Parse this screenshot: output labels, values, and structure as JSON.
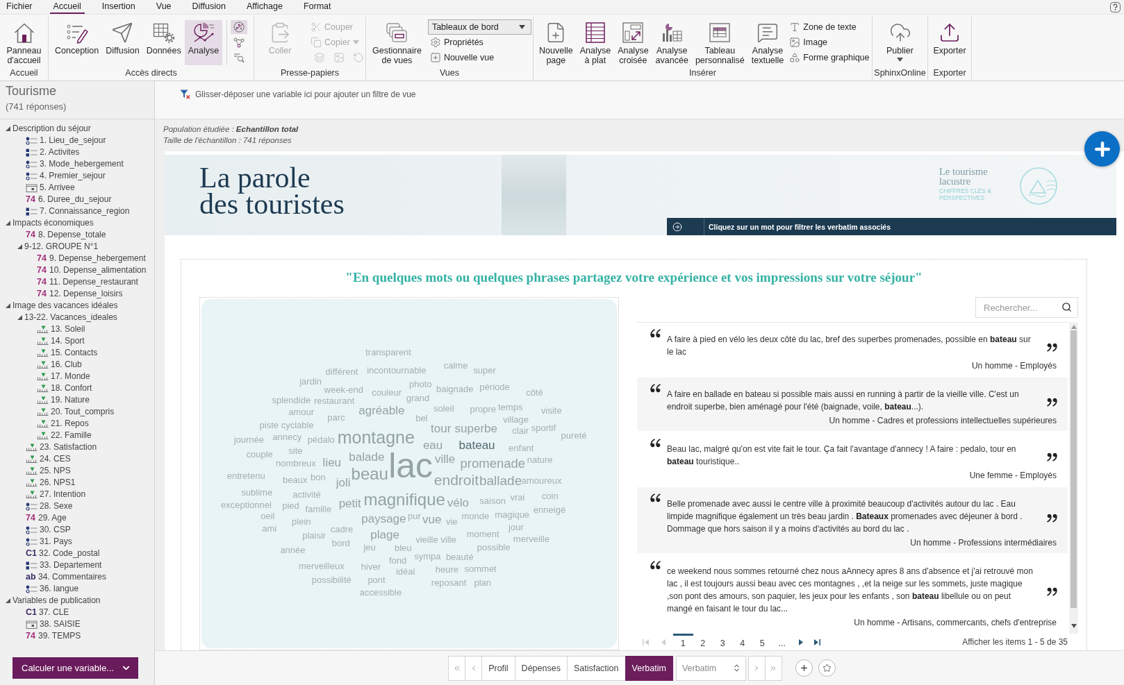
{
  "menu": [
    {
      "label": "Fichier",
      "selected": false
    },
    {
      "label": "Accueil",
      "selected": true
    },
    {
      "label": "Insertion",
      "selected": false
    },
    {
      "label": "Vue",
      "selected": false
    },
    {
      "label": "Diffusion",
      "selected": false
    },
    {
      "label": "Affichage",
      "selected": false
    },
    {
      "label": "Format",
      "selected": false
    }
  ],
  "ribbon": [
    {
      "label": "Accueil",
      "items": [
        {
          "kind": "large",
          "label": "Panneau\nd'accueil"
        }
      ]
    },
    {
      "label": "Accès directs",
      "items": [
        {
          "kind": "large",
          "label": "Conception",
          "selected": false
        },
        {
          "kind": "large",
          "label": "Diffusion",
          "selected": false
        },
        {
          "kind": "large",
          "label": "Données",
          "selected": false
        },
        {
          "kind": "large",
          "label": "Analyse",
          "selected": true
        },
        {
          "kind": "icon_stack",
          "items": [
            {
              "selected": true
            },
            {
              "selected": false
            },
            {
              "selected": false
            }
          ]
        }
      ]
    },
    {
      "label": "Presse-papiers",
      "items": [
        {
          "kind": "large",
          "label": "Coller",
          "disabled": true
        },
        {
          "kind": "stack",
          "items": [
            {
              "kind": "small",
              "label": "Couper",
              "disabled": true
            },
            {
              "kind": "small",
              "label": "Copier",
              "disabled": true,
              "caret": true
            },
            {
              "kind": "icons",
              "items": [
                {
                  "disabled": true
                },
                {
                  "disabled": true
                },
                {
                  "disabled": true
                }
              ]
            }
          ]
        }
      ]
    },
    {
      "label": "Vues",
      "items": [
        {
          "kind": "large",
          "label": "Gestionnaire\nde vues"
        },
        {
          "kind": "stack",
          "items": [
            {
              "kind": "dropdown",
              "value": "Tableaux de bord"
            },
            {
              "kind": "small",
              "label": "Propriétés"
            },
            {
              "kind": "small",
              "label": "Nouvelle vue"
            }
          ]
        }
      ]
    },
    {
      "label": "Insérer",
      "items": [
        {
          "kind": "large",
          "label": "Nouvelle\npage"
        },
        {
          "kind": "large",
          "label": "Analyse\nà plat"
        },
        {
          "kind": "large",
          "label": "Analyse\ncroisée"
        },
        {
          "kind": "large",
          "label": "Analyse\navancée"
        },
        {
          "kind": "large",
          "label": "Tableau\npersonnalisé"
        },
        {
          "kind": "large",
          "label": "Analyse\ntextuelle"
        },
        {
          "kind": "stack",
          "items": [
            {
              "kind": "small",
              "label": "Zone de texte"
            },
            {
              "kind": "small",
              "label": "Image"
            },
            {
              "kind": "small",
              "label": "Forme graphique"
            }
          ]
        }
      ]
    },
    {
      "label": "SphinxOnline",
      "items": [
        {
          "kind": "large",
          "label": "Publier",
          "caret": true
        }
      ]
    },
    {
      "label": "Exporter",
      "items": [
        {
          "kind": "large",
          "label": "Exporter"
        }
      ]
    }
  ],
  "sidebar": {
    "title": "Tourisme",
    "subtitle": "(741 réponses)",
    "variables": [
      {
        "kind": "group",
        "label": "Description du séjour",
        "expanded": true,
        "children": [
          {
            "kind": "single",
            "label": "1. Lieu_de_sejour"
          },
          {
            "kind": "multi",
            "label": "2. Activites"
          },
          {
            "kind": "single",
            "label": "3. Mode_hebergement"
          },
          {
            "kind": "single",
            "label": "4. Premier_sejour"
          },
          {
            "kind": "date",
            "label": "5. Arrivee"
          },
          {
            "kind": "numeric",
            "badge": "74",
            "label": "6. Duree_du_sejour"
          },
          {
            "kind": "multi",
            "label": "7. Connaissance_region"
          }
        ]
      },
      {
        "kind": "group",
        "label": "Impacts économiques",
        "expanded": true,
        "children": [
          {
            "kind": "numeric",
            "badge": "74",
            "label": "8. Depense_totale"
          },
          {
            "kind": "group",
            "label": "9-12. GROUPE N°1",
            "expanded": true,
            "children": [
              {
                "kind": "numeric",
                "badge": "74",
                "label": "9. Depense_hebergement"
              },
              {
                "kind": "numeric",
                "badge": "74",
                "label": "10. Depense_alimentation"
              },
              {
                "kind": "numeric",
                "badge": "74",
                "label": "11. Depense_restaurant"
              },
              {
                "kind": "numeric",
                "badge": "74",
                "label": "12. Depense_loisirs"
              }
            ]
          }
        ]
      },
      {
        "kind": "group",
        "label": "Image des vacances idéales",
        "expanded": true,
        "children": [
          {
            "kind": "group",
            "label": "13-22. Vacances_ideales",
            "expanded": true,
            "children": [
              {
                "kind": "scale",
                "label": "13. Soleil"
              },
              {
                "kind": "scale",
                "label": "14. Sport"
              },
              {
                "kind": "scale",
                "label": "15. Contacts"
              },
              {
                "kind": "scale",
                "label": "16. Club"
              },
              {
                "kind": "scale",
                "label": "17. Monde"
              },
              {
                "kind": "scale",
                "label": "18. Confort"
              },
              {
                "kind": "scale",
                "label": "19. Nature"
              },
              {
                "kind": "scale",
                "label": "20. Tout_compris"
              },
              {
                "kind": "scale",
                "label": "21. Repos"
              },
              {
                "kind": "scale",
                "label": "22. Famille"
              }
            ]
          },
          {
            "kind": "scale",
            "label": "23. Satisfaction"
          },
          {
            "kind": "scale",
            "label": "24. CES"
          },
          {
            "kind": "scale",
            "label": "25. NPS"
          },
          {
            "kind": "scale",
            "label": "26. NPS1"
          },
          {
            "kind": "scale",
            "label": "27. Intention"
          },
          {
            "kind": "single",
            "label": "28. Sexe"
          },
          {
            "kind": "numeric",
            "badge": "74",
            "label": "29. Age"
          },
          {
            "kind": "single",
            "label": "30. CSP"
          },
          {
            "kind": "single",
            "label": "31. Pays"
          },
          {
            "kind": "code",
            "badge": "C1",
            "label": "32. Code_postal"
          },
          {
            "kind": "multi",
            "label": "33. Departement"
          },
          {
            "kind": "text",
            "badge": "ab",
            "label": "34. Commentaires"
          },
          {
            "kind": "single",
            "label": "36. langue"
          }
        ]
      },
      {
        "kind": "group",
        "label": "Variables de publication",
        "expanded": true,
        "children": [
          {
            "kind": "code",
            "badge": "C1",
            "label": "37. CLE"
          },
          {
            "kind": "date",
            "label": "38. SAISIE"
          },
          {
            "kind": "numeric",
            "badge": "74",
            "label": "39. TEMPS"
          }
        ]
      }
    ],
    "button": "Calculer une variable..."
  },
  "filter_bar": {
    "hint": "Glisser-déposer une variable ici pour ajouter un filtre de vue"
  },
  "population": [
    "Population étudiée : **Echantillon total**",
    "Taille de l'échantillon : 741 réponses"
  ],
  "dashboard": {
    "banner": {
      "title": "La parole\ndes touristes",
      "logo_title": "Le tourisme lacustre",
      "logo_subtitle": "CHIFFRES CLÉS & PERSPECTIVES",
      "hint": "Cliquez sur un mot pour filtrer les verbatim associés"
    },
    "question": "\"En quelques mots ou quelques phrases partagez votre expérience et vos impressions sur votre séjour\"",
    "word_cloud": [
      {
        "word": "transparent",
        "selected": false
      },
      {
        "word": "calme",
        "selected": false
      },
      {
        "word": "différent",
        "selected": false
      },
      {
        "word": "incontournable",
        "selected": false
      },
      {
        "word": "super",
        "selected": false
      },
      {
        "word": "jardin",
        "selected": false
      },
      {
        "word": "week-end",
        "selected": false
      },
      {
        "word": "couleur",
        "selected": false
      },
      {
        "word": "photo",
        "selected": false
      },
      {
        "word": "baignade",
        "selected": false
      },
      {
        "word": "période",
        "selected": false
      },
      {
        "word": "côté",
        "selected": false
      },
      {
        "word": "splendide",
        "selected": false
      },
      {
        "word": "restaurant",
        "selected": false
      },
      {
        "word": "grand",
        "selected": false
      },
      {
        "word": "amour",
        "selected": false
      },
      {
        "word": "agréable",
        "selected": false
      },
      {
        "word": "soleil",
        "selected": false
      },
      {
        "word": "propre",
        "selected": false
      },
      {
        "word": "temps",
        "selected": false
      },
      {
        "word": "visite",
        "selected": false
      },
      {
        "word": "parc",
        "selected": false
      },
      {
        "word": "bel",
        "selected": false
      },
      {
        "word": "village",
        "selected": false
      },
      {
        "word": "piste cyclable",
        "selected": false
      },
      {
        "word": "tour",
        "selected": false
      },
      {
        "word": "superbe",
        "selected": false
      },
      {
        "word": "clair",
        "selected": false
      },
      {
        "word": "sportif",
        "selected": false
      },
      {
        "word": "journée",
        "selected": false
      },
      {
        "word": "annecy",
        "selected": false
      },
      {
        "word": "pédalo",
        "selected": false
      },
      {
        "word": "montagne",
        "selected": false
      },
      {
        "word": "pureté",
        "selected": false
      },
      {
        "word": "couple",
        "selected": false
      },
      {
        "word": "site",
        "selected": false
      },
      {
        "word": "eau",
        "selected": false
      },
      {
        "word": "bateau",
        "selected": true
      },
      {
        "word": "enfant",
        "selected": false
      },
      {
        "word": "nombreux",
        "selected": false
      },
      {
        "word": "lieu",
        "selected": false
      },
      {
        "word": "balade",
        "selected": false
      },
      {
        "word": "lac",
        "selected": false
      },
      {
        "word": "ville",
        "selected": false
      },
      {
        "word": "promenade",
        "selected": false
      },
      {
        "word": "nature",
        "selected": false
      },
      {
        "word": "entretenu",
        "selected": false
      },
      {
        "word": "beaux",
        "selected": false
      },
      {
        "word": "bon",
        "selected": false
      },
      {
        "word": "joli",
        "selected": false
      },
      {
        "word": "beau",
        "selected": false
      },
      {
        "word": "endroit",
        "selected": false
      },
      {
        "word": "ballade",
        "selected": false
      },
      {
        "word": "amoureux",
        "selected": false
      },
      {
        "word": "sublime",
        "selected": false
      },
      {
        "word": "activité",
        "selected": false
      },
      {
        "word": "magnifique",
        "selected": false
      },
      {
        "word": "saison",
        "selected": false
      },
      {
        "word": "vrai",
        "selected": false
      },
      {
        "word": "coin",
        "selected": false
      },
      {
        "word": "exceptionnel",
        "selected": false
      },
      {
        "word": "pied",
        "selected": false
      },
      {
        "word": "famille",
        "selected": false
      },
      {
        "word": "petit",
        "selected": false
      },
      {
        "word": "vélo",
        "selected": false
      },
      {
        "word": "enneigé",
        "selected": false
      },
      {
        "word": "oeil",
        "selected": false
      },
      {
        "word": "plein",
        "selected": false
      },
      {
        "word": "paysage",
        "selected": false
      },
      {
        "word": "pur",
        "selected": false
      },
      {
        "word": "vue",
        "selected": false
      },
      {
        "word": "vie",
        "selected": false
      },
      {
        "word": "monde",
        "selected": false
      },
      {
        "word": "magique",
        "selected": false
      },
      {
        "word": "ami",
        "selected": false
      },
      {
        "word": "cadre",
        "selected": false
      },
      {
        "word": "jour",
        "selected": false
      },
      {
        "word": "plaisir",
        "selected": false
      },
      {
        "word": "plage",
        "selected": false
      },
      {
        "word": "vieille ville",
        "selected": false
      },
      {
        "word": "moment",
        "selected": false
      },
      {
        "word": "merveille",
        "selected": false
      },
      {
        "word": "année",
        "selected": false
      },
      {
        "word": "bord",
        "selected": false
      },
      {
        "word": "jeu",
        "selected": false
      },
      {
        "word": "bleu",
        "selected": false
      },
      {
        "word": "possible",
        "selected": false
      },
      {
        "word": "fond",
        "selected": false
      },
      {
        "word": "sympa",
        "selected": false
      },
      {
        "word": "beauté",
        "selected": false
      },
      {
        "word": "merveilleux",
        "selected": false
      },
      {
        "word": "hiver",
        "selected": false
      },
      {
        "word": "idéal",
        "selected": false
      },
      {
        "word": "heure",
        "selected": false
      },
      {
        "word": "sommet",
        "selected": false
      },
      {
        "word": "possibilité",
        "selected": false
      },
      {
        "word": "pont",
        "selected": false
      },
      {
        "word": "reposant",
        "selected": false
      },
      {
        "word": "plan",
        "selected": false
      },
      {
        "word": "accessible",
        "selected": false
      }
    ],
    "search": {
      "placeholder": "Rechercher..."
    },
    "verbatims": [
      {
        "text": "A faire à pied en vélo les deux côté du lac, bref des superbes promenades, possible en **bateau** sur le lac",
        "author": "Un homme - Employés"
      },
      {
        "text": "A faire en ballade en bateau si possible mais aussi en running à partir de la vieille ville. C'est un endroit superbe, bien aménagé pour l'été (baignade, voile, **bateau**...).",
        "author": "Un homme - Cadres et professions intellectuelles supérieures"
      },
      {
        "text": "Beau lac, malgré qu'on est vite fait le tour. Ça fait l'avantage d'annecy ! A faire : pedalo, tour en **bateau** touristique..",
        "author": "Une femme - Employés"
      },
      {
        "text": "Belle promenade avec aussi le centre ville à proximité beaucoup d'activités autour du lac . Eau limpide magnifique également un très beau jardin . **Bateaux** promenades avec déjeuner à bord . Dommage que hors saison il y a moins d'activités au bord du lac .",
        "author": "Un homme - Professions intermédiaires"
      },
      {
        "text": "ce weekend nous sommes retourné chez nous aAnnecy apres 8 ans d'absence et j'ai retrouvé mon lac , il est toujours aussi beau avec ces montagnes , ,et la neige sur les sommets, juste magique ,son pont des amours, son paquier, les jeux pour les enfants , son **bateau** libellule ou on peut mangé en faisant le tour du lac...",
        "author": "Un homme - Artisans, commercants, chefs d'entreprise"
      }
    ],
    "pagination": {
      "before": [
        {
          "kind": "first",
          "disabled": true
        },
        {
          "kind": "previous",
          "disabled": true
        }
      ],
      "pages": [
        {
          "label": "1",
          "selected": true
        },
        {
          "label": "2",
          "selected": false
        },
        {
          "label": "3",
          "selected": false
        },
        {
          "label": "4",
          "selected": false
        },
        {
          "label": "5",
          "selected": false
        },
        {
          "label": "...",
          "selected": false
        }
      ],
      "after": [
        {
          "kind": "next",
          "disabled": false
        },
        {
          "kind": "last",
          "disabled": false
        }
      ],
      "summary": "Afficher les items 1 - 5 de 35"
    }
  },
  "view_tabs": {
    "tabs": [
      {
        "label": "Profil",
        "selected": false
      },
      {
        "label": "Dépenses",
        "selected": false
      },
      {
        "label": "Satisfaction",
        "selected": false
      },
      {
        "label": "Verbatim",
        "selected": true
      }
    ],
    "select": "Verbatim"
  }
}
